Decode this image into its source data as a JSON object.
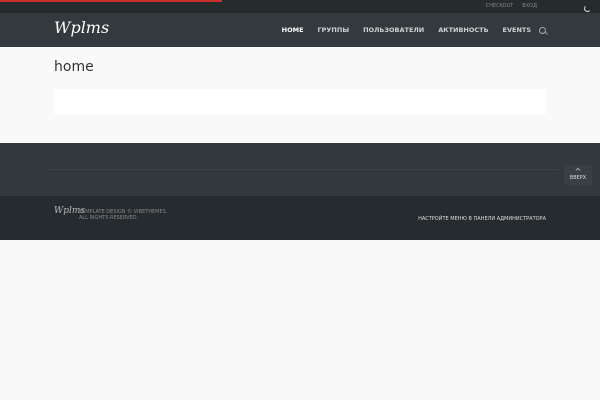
{
  "topbar": {
    "links": [
      "CHECKOUT",
      "ВХОД"
    ],
    "progress": 0.37
  },
  "header": {
    "logo": "Wplms",
    "nav": [
      "HOME",
      "ГРУППЫ",
      "ПОЛЬЗОВАТЕЛИ",
      "АКТИВНОСТЬ",
      "EVENTS"
    ]
  },
  "main": {
    "title": "home"
  },
  "footer": {
    "to_top": "ВВЕРХ",
    "logo": "Wplms",
    "copyright": "TEMPLATE DESIGN © VIBETHEMES. ALL RIGHTS RESERVED.",
    "menu_note": "НАСТРОЙТЕ МЕНЮ В ПАНЕЛИ АДМИНИСТРАТОРА"
  }
}
